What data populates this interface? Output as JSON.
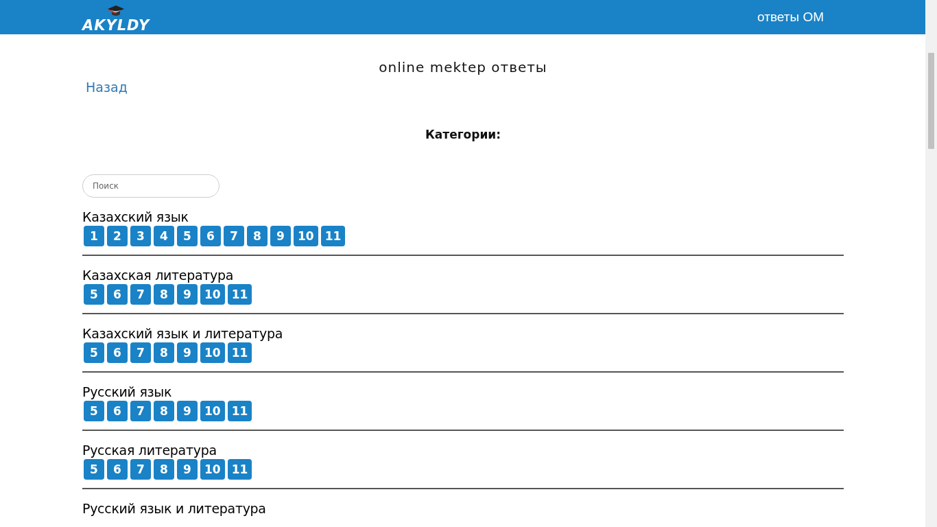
{
  "header": {
    "logo_text": "AKYLDY",
    "nav_link": "ответы ОМ"
  },
  "page_title": "online mektep ответы",
  "back_link": "Назад",
  "categories_heading": "Категории:",
  "search": {
    "placeholder": "Поиск"
  },
  "categories": [
    {
      "name": "Казахский язык",
      "grades": [
        "1",
        "2",
        "3",
        "4",
        "5",
        "6",
        "7",
        "8",
        "9",
        "10",
        "11"
      ]
    },
    {
      "name": "Казахская литература",
      "grades": [
        "5",
        "6",
        "7",
        "8",
        "9",
        "10",
        "11"
      ]
    },
    {
      "name": "Казахский язык и литература",
      "grades": [
        "5",
        "6",
        "7",
        "8",
        "9",
        "10",
        "11"
      ]
    },
    {
      "name": "Русский язык",
      "grades": [
        "5",
        "6",
        "7",
        "8",
        "9",
        "10",
        "11"
      ]
    },
    {
      "name": "Русская литература",
      "grades": [
        "5",
        "6",
        "7",
        "8",
        "9",
        "10",
        "11"
      ]
    },
    {
      "name": "Русский язык и литература"
    }
  ]
}
